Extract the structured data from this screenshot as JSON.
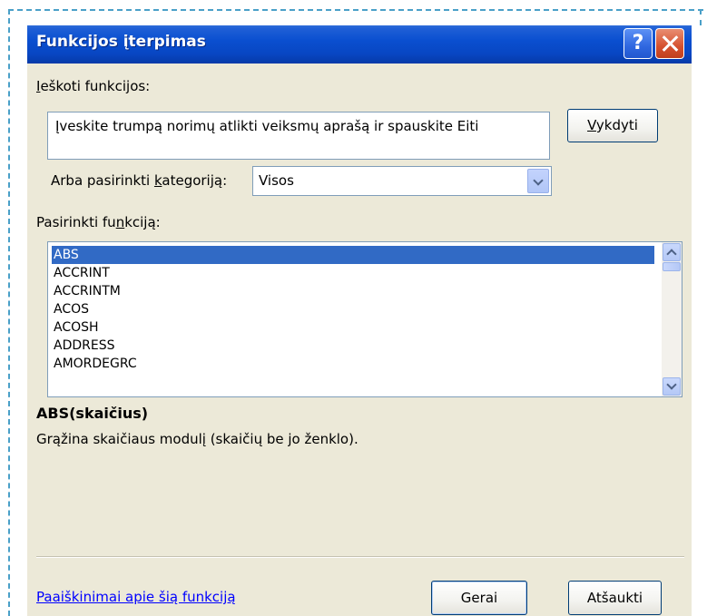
{
  "window": {
    "title": "Funkcijos įterpimas",
    "help_label": "?"
  },
  "search": {
    "label_prefix": "",
    "label_access": "I",
    "label_rest": "eškoti funkcijos:",
    "value": "Įveskite trumpą norimų atlikti veiksmų aprašą ir spauskite Eiti",
    "go_access": "V",
    "go_rest": "ykdyti"
  },
  "category": {
    "label_prefix": "Arba pasirinkti ",
    "label_access": "k",
    "label_rest": "ategoriją:",
    "selected": "Visos"
  },
  "functions": {
    "label_prefix": "Pasirinkti fu",
    "label_access": "n",
    "label_rest": "kciją:",
    "items": [
      "ABS",
      "ACCRINT",
      "ACCRINTM",
      "ACOS",
      "ACOSH",
      "ADDRESS",
      "AMORDEGRC"
    ],
    "selected_index": 0
  },
  "details": {
    "signature": "ABS(skaičius)",
    "description": "Grąžina skaičiaus modulį (skaičių be jo ženklo)."
  },
  "footer": {
    "help_link": "Paaiškinimai apie šią funkciją",
    "ok": "Gerai",
    "cancel": "Atšaukti"
  },
  "colors": {
    "titlebar": "#0a4fd0",
    "dialog_bg": "#ece9d8",
    "selection": "#316ac5",
    "link": "#0000ff"
  }
}
